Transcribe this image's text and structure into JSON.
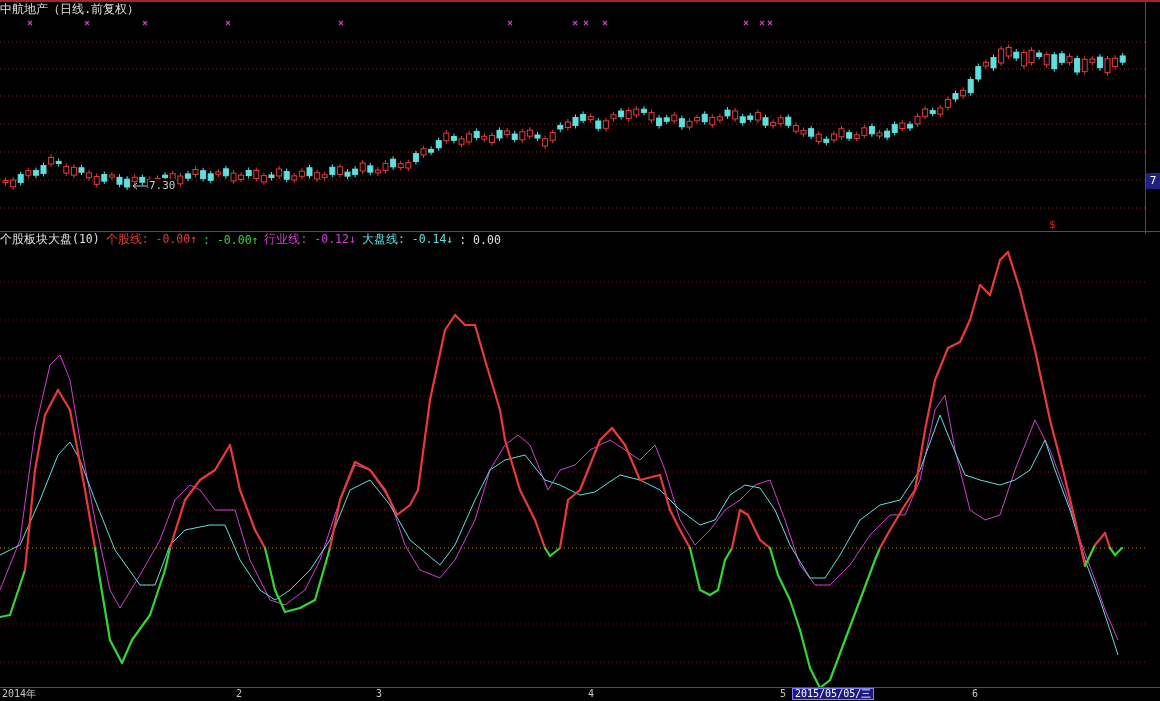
{
  "price_panel": {
    "title": "中航地产（日线.前复权）",
    "low_label": "7.30",
    "axis_label": "7",
    "signal_mark": "$"
  },
  "indicator": {
    "name": "个股板块大盘(10)",
    "items": [
      {
        "label": "个股线:",
        "value": "-0.00",
        "arrow": "↑",
        "color": "#e83a3a"
      },
      {
        "label": ":",
        "value": "-0.00",
        "arrow": "↑",
        "color": "#33d633"
      },
      {
        "label": "行业线:",
        "value": "-0.12",
        "arrow": "↓",
        "color": "#d040d0"
      },
      {
        "label": "大盘线:",
        "value": "-0.14",
        "arrow": "↓",
        "color": "#5fe0e0"
      },
      {
        "label": ":",
        "value": "0.00",
        "color": "#e0e0e0"
      }
    ]
  },
  "date_axis": {
    "labels": [
      {
        "text": "2014年",
        "highlighted": false
      },
      {
        "text": "2",
        "highlighted": false
      },
      {
        "text": "3",
        "highlighted": false
      },
      {
        "text": "4",
        "highlighted": false
      },
      {
        "text": "5",
        "highlighted": false
      },
      {
        "text": "2015/05/05/三",
        "highlighted": true
      },
      {
        "text": "6",
        "highlighted": false
      }
    ]
  }
}
